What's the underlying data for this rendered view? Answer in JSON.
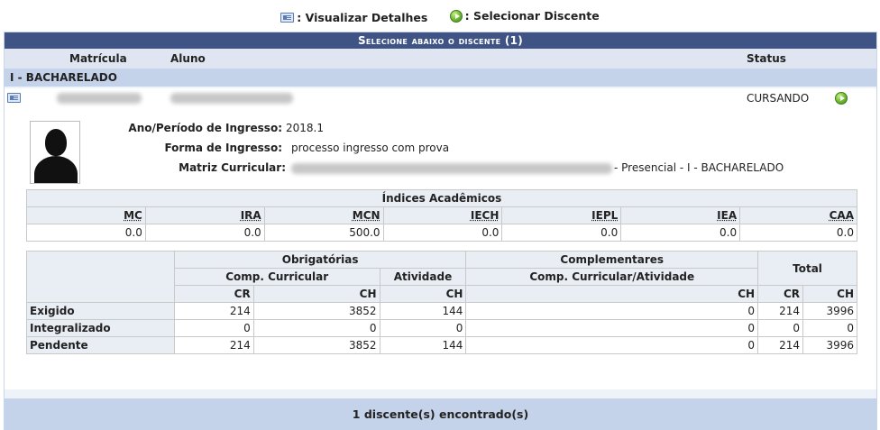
{
  "legend": {
    "details_label": ": Visualizar Detalhes",
    "select_label": ": Selecionar Discente"
  },
  "caption": "Selecione abaixo o discente (1)",
  "columns": {
    "matricula": "Matrícula",
    "aluno": "Aluno",
    "status": "Status"
  },
  "group_label": "I - BACHARELADO",
  "student": {
    "status": "CURSANDO",
    "ingresso_label": "Ano/Período de Ingresso:",
    "ingresso_value": "2018.1",
    "forma_label": "Forma de Ingresso:",
    "forma_value": "processo ingresso com prova",
    "matriz_label": "Matriz Curricular:",
    "matriz_suffix": "- Presencial - I - BACHARELADO"
  },
  "indices": {
    "title": "Índices Acadêmicos",
    "headers": [
      "MC",
      "IRA",
      "MCN",
      "IECH",
      "IEPL",
      "IEA",
      "CAA"
    ],
    "values": [
      "0.0",
      "0.0",
      "500.0",
      "0.0",
      "0.0",
      "0.0",
      "0.0"
    ]
  },
  "ch_table": {
    "obrigatorias": "Obrigatórias",
    "complementares": "Complementares",
    "total": "Total",
    "comp_curricular": "Comp. Curricular",
    "atividade": "Atividade",
    "comp_curricular_atividade": "Comp. Curricular/Atividade",
    "cr": "CR",
    "ch": "CH",
    "rows": [
      {
        "label": "Exigido",
        "cc_cr": "214",
        "cc_ch": "3852",
        "at_ch": "144",
        "comp_ch": "0",
        "tot_cr": "214",
        "tot_ch": "3996"
      },
      {
        "label": "Integralizado",
        "cc_cr": "0",
        "cc_ch": "0",
        "at_ch": "0",
        "comp_ch": "0",
        "tot_cr": "0",
        "tot_ch": "0"
      },
      {
        "label": "Pendente",
        "cc_cr": "214",
        "cc_ch": "3852",
        "at_ch": "144",
        "comp_ch": "0",
        "tot_cr": "214",
        "tot_ch": "3996"
      }
    ]
  },
  "footer": "1 discente(s) encontrado(s)"
}
